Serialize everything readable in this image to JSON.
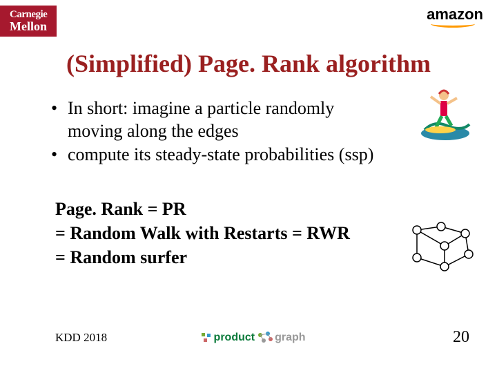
{
  "header": {
    "cmu_line1": "Carnegie",
    "cmu_line2": "Mellon",
    "amazon": "amazon"
  },
  "title": "(Simplified) Page. Rank algorithm",
  "bullets": [
    "In short: imagine a particle randomly moving along the edges",
    "compute its steady-state probabilities (ssp)"
  ],
  "equations": {
    "line1": "Page. Rank = PR",
    "line2": "= Random Walk with Restarts = RWR",
    "line3": "= Random surfer"
  },
  "footer": {
    "left": "KDD 2018",
    "center_p1": "product",
    "center_p2": "graph",
    "page": "20"
  },
  "icons": {
    "surfer": "surfer-illustration",
    "network": "network-graph-illustration"
  }
}
